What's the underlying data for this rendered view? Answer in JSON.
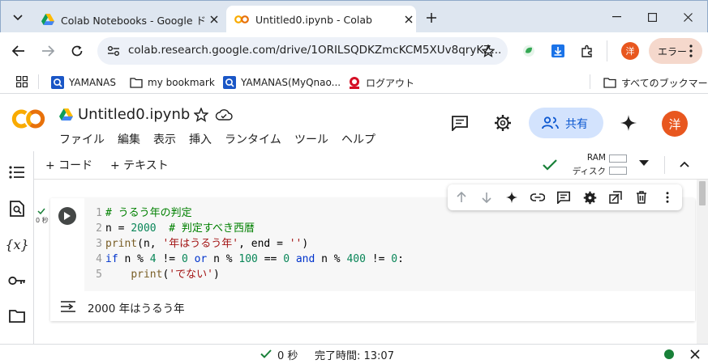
{
  "browser": {
    "tabs": [
      {
        "title": "Colab Notebooks - Google ドライ",
        "icon": "google-drive-icon",
        "active": false
      },
      {
        "title": "Untitled0.ipynb - Colab",
        "icon": "colab-icon",
        "active": true
      }
    ],
    "url": "colab.research.google.com/drive/1ORILSQDKZmcKCM5XUv8qryKZ...",
    "profile_initial": "洋",
    "error_label": "エラー"
  },
  "bookmarks": {
    "items": [
      {
        "label": "YAMANAS",
        "icon": "yamanas-icon"
      },
      {
        "label": "my bookmark",
        "icon": "folder-icon"
      },
      {
        "label": "YAMANAS(MyQnao...",
        "icon": "yamanas-icon"
      },
      {
        "label": "ログアウト",
        "icon": "mufg-icon"
      }
    ],
    "all_bookmarks": "すべてのブックマーク"
  },
  "colab": {
    "notebook_title": "Untitled0.ipynb",
    "menu": [
      "ファイル",
      "編集",
      "表示",
      "挿入",
      "ランタイム",
      "ツール",
      "ヘルプ"
    ],
    "share_label": "共有",
    "user_initial": "洋",
    "add_code": "+ コード",
    "add_text": "+ テキスト",
    "ram_label": "RAM",
    "disk_label": "ディスク"
  },
  "cell": {
    "exec_time": "0 秒",
    "code_lines": [
      {
        "num": "1",
        "text": "# うるう年の判定"
      },
      {
        "num": "2",
        "text": "n = 2000  # 判定すべき西暦"
      },
      {
        "num": "3",
        "text": "print(n, '年はうるう年', end = '')"
      },
      {
        "num": "4",
        "text": "if n % 4 != 0 or n % 100 == 0 and n % 400 != 0:"
      },
      {
        "num": "5",
        "text": "    print('でない')"
      }
    ],
    "output": "2000 年はうるう年"
  },
  "status": {
    "time": "0 秒",
    "completed": "完了時間: 13:07"
  },
  "colors": {
    "colab_orange": "#f9ab00",
    "accent_blue": "#1a73e8",
    "profile_orange": "#e8571f",
    "ok_green": "#188038"
  }
}
